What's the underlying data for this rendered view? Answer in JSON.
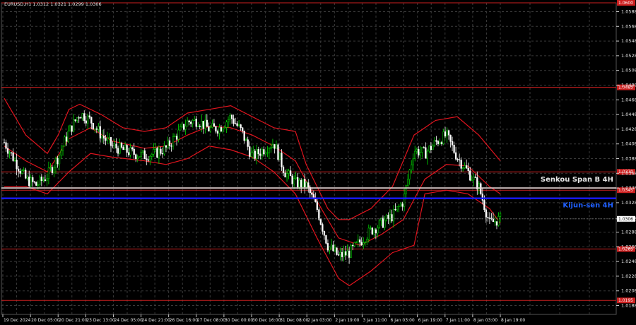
{
  "chart_title": "EURUSD,H1  1.0312 1.0321 1.0299 1.0306",
  "chart_data": {
    "type": "candlestick",
    "symbol": "EURUSD",
    "timeframe": "H1",
    "ohlc_header": {
      "open": "1.0312",
      "high": "1.0321",
      "low": "1.0299",
      "close": "1.0306"
    },
    "ylim": [
      1.0176,
      1.06
    ],
    "y_tick_labels": [
      "1.0588",
      "1.0568",
      "1.0548",
      "1.0528",
      "1.0508",
      "1.0488",
      "1.0468",
      "1.0448",
      "1.0428",
      "1.0408",
      "1.0388",
      "1.0368",
      "1.0348",
      "1.0328",
      "1.0306",
      "1.0288",
      "1.0268",
      "1.0248",
      "1.0228",
      "1.0208",
      "1.0188"
    ],
    "x_tick_labels": [
      "19 Dec 2024",
      "20 Dec 05:00",
      "20 Dec 21:00",
      "23 Dec 13:00",
      "24 Dec 05:00",
      "24 Dec 21:00",
      "26 Dec 16:00",
      "27 Dec 08:00",
      "30 Dec 00:00",
      "30 Dec 16:00",
      "31 Dec 08:00",
      "2 Jan 03:00",
      "2 Jan 19:00",
      "3 Jan 11:00",
      "6 Jan 03:00",
      "6 Jan 19:00",
      "7 Jan 11:00",
      "8 Jan 03:00",
      "8 Jan 19:00"
    ],
    "horizontal_levels": [
      {
        "price": 1.06,
        "label": "1.0600",
        "color": "#cc1f1f"
      },
      {
        "price": 1.0485,
        "label": "1.0485",
        "color": "#cc1f1f"
      },
      {
        "price": 1.037,
        "label": "1.0370",
        "color": "#cc1f1f"
      },
      {
        "price": 1.0345,
        "label": "1.0345",
        "color": "#cc1f1f"
      },
      {
        "price": 1.0265,
        "label": "1.0265",
        "color": "#cc1f1f"
      },
      {
        "price": 1.0195,
        "label": "1.0195",
        "color": "#cc1f1f"
      }
    ],
    "ichimoku_lines": [
      {
        "name": "Senkou Span B 4H",
        "price": 1.0348,
        "color": "#e8d6d6"
      },
      {
        "name": "Kijun-sen 4H",
        "price": 1.0334,
        "color": "#1a1aff"
      }
    ],
    "last_price": {
      "price": 1.0306,
      "label": "1.0306"
    },
    "close_path": [
      [
        0,
        1.041
      ],
      [
        2,
        1.0385
      ],
      [
        4,
        1.036
      ],
      [
        6,
        1.0352
      ],
      [
        8,
        1.0365
      ],
      [
        10,
        1.039
      ],
      [
        12,
        1.0425
      ],
      [
        14,
        1.045
      ],
      [
        16,
        1.044
      ],
      [
        18,
        1.042
      ],
      [
        20,
        1.0405
      ],
      [
        22,
        1.04
      ],
      [
        24,
        1.0395
      ],
      [
        26,
        1.0392
      ],
      [
        28,
        1.0395
      ],
      [
        30,
        1.0402
      ],
      [
        32,
        1.042
      ],
      [
        34,
        1.0438
      ],
      [
        36,
        1.044
      ],
      [
        38,
        1.0428
      ],
      [
        40,
        1.043
      ],
      [
        42,
        1.0445
      ],
      [
        44,
        1.0425
      ],
      [
        46,
        1.039
      ],
      [
        48,
        1.04
      ],
      [
        50,
        1.041
      ],
      [
        52,
        1.037
      ],
      [
        54,
        1.0355
      ],
      [
        56,
        1.0352
      ],
      [
        58,
        1.032
      ],
      [
        60,
        1.027
      ],
      [
        62,
        1.0255
      ],
      [
        64,
        1.026
      ],
      [
        66,
        1.0275
      ],
      [
        68,
        1.029
      ],
      [
        70,
        1.03
      ],
      [
        72,
        1.031
      ],
      [
        74,
        1.033
      ],
      [
        76,
        1.04
      ],
      [
        78,
        1.0395
      ],
      [
        80,
        1.041
      ],
      [
        82,
        1.042
      ],
      [
        84,
        1.039
      ],
      [
        86,
        1.037
      ],
      [
        88,
        1.035
      ],
      [
        90,
        1.03
      ],
      [
        92,
        1.0306
      ]
    ],
    "bollinger": {
      "upper": [
        [
          0,
          1.047
        ],
        [
          4,
          1.042
        ],
        [
          8,
          1.0395
        ],
        [
          10,
          1.042
        ],
        [
          12,
          1.0455
        ],
        [
          14,
          1.0462
        ],
        [
          16,
          1.0455
        ],
        [
          18,
          1.0448
        ],
        [
          22,
          1.043
        ],
        [
          26,
          1.0425
        ],
        [
          30,
          1.043
        ],
        [
          34,
          1.045
        ],
        [
          38,
          1.0455
        ],
        [
          42,
          1.046
        ],
        [
          46,
          1.0445
        ],
        [
          50,
          1.043
        ],
        [
          54,
          1.0425
        ],
        [
          56,
          1.038
        ],
        [
          58,
          1.035
        ],
        [
          60,
          1.032
        ],
        [
          62,
          1.0305
        ],
        [
          64,
          1.0305
        ],
        [
          68,
          1.032
        ],
        [
          72,
          1.035
        ],
        [
          76,
          1.042
        ],
        [
          80,
          1.044
        ],
        [
          84,
          1.0445
        ],
        [
          88,
          1.042
        ],
        [
          92,
          1.0385
        ]
      ],
      "middle": [
        [
          0,
          1.0405
        ],
        [
          4,
          1.0385
        ],
        [
          8,
          1.037
        ],
        [
          12,
          1.0415
        ],
        [
          16,
          1.043
        ],
        [
          20,
          1.0412
        ],
        [
          26,
          1.0402
        ],
        [
          30,
          1.0405
        ],
        [
          34,
          1.042
        ],
        [
          38,
          1.0432
        ],
        [
          42,
          1.043
        ],
        [
          46,
          1.042
        ],
        [
          50,
          1.0405
        ],
        [
          54,
          1.0385
        ],
        [
          58,
          1.033
        ],
        [
          62,
          1.028
        ],
        [
          66,
          1.027
        ],
        [
          70,
          1.0285
        ],
        [
          74,
          1.0305
        ],
        [
          78,
          1.036
        ],
        [
          82,
          1.038
        ],
        [
          86,
          1.0378
        ],
        [
          90,
          1.035
        ],
        [
          92,
          1.034
        ]
      ],
      "lower": [
        [
          0,
          1.035
        ],
        [
          4,
          1.035
        ],
        [
          8,
          1.034
        ],
        [
          12,
          1.037
        ],
        [
          16,
          1.0395
        ],
        [
          20,
          1.039
        ],
        [
          26,
          1.0385
        ],
        [
          30,
          1.038
        ],
        [
          34,
          1.0388
        ],
        [
          38,
          1.0405
        ],
        [
          42,
          1.04
        ],
        [
          46,
          1.039
        ],
        [
          50,
          1.037
        ],
        [
          54,
          1.034
        ],
        [
          58,
          1.028
        ],
        [
          62,
          1.0225
        ],
        [
          64,
          1.0215
        ],
        [
          68,
          1.0235
        ],
        [
          72,
          1.026
        ],
        [
          76,
          1.027
        ],
        [
          78,
          1.034
        ],
        [
          82,
          1.0345
        ],
        [
          86,
          1.034
        ],
        [
          90,
          1.032
        ],
        [
          92,
          1.03
        ]
      ]
    }
  }
}
